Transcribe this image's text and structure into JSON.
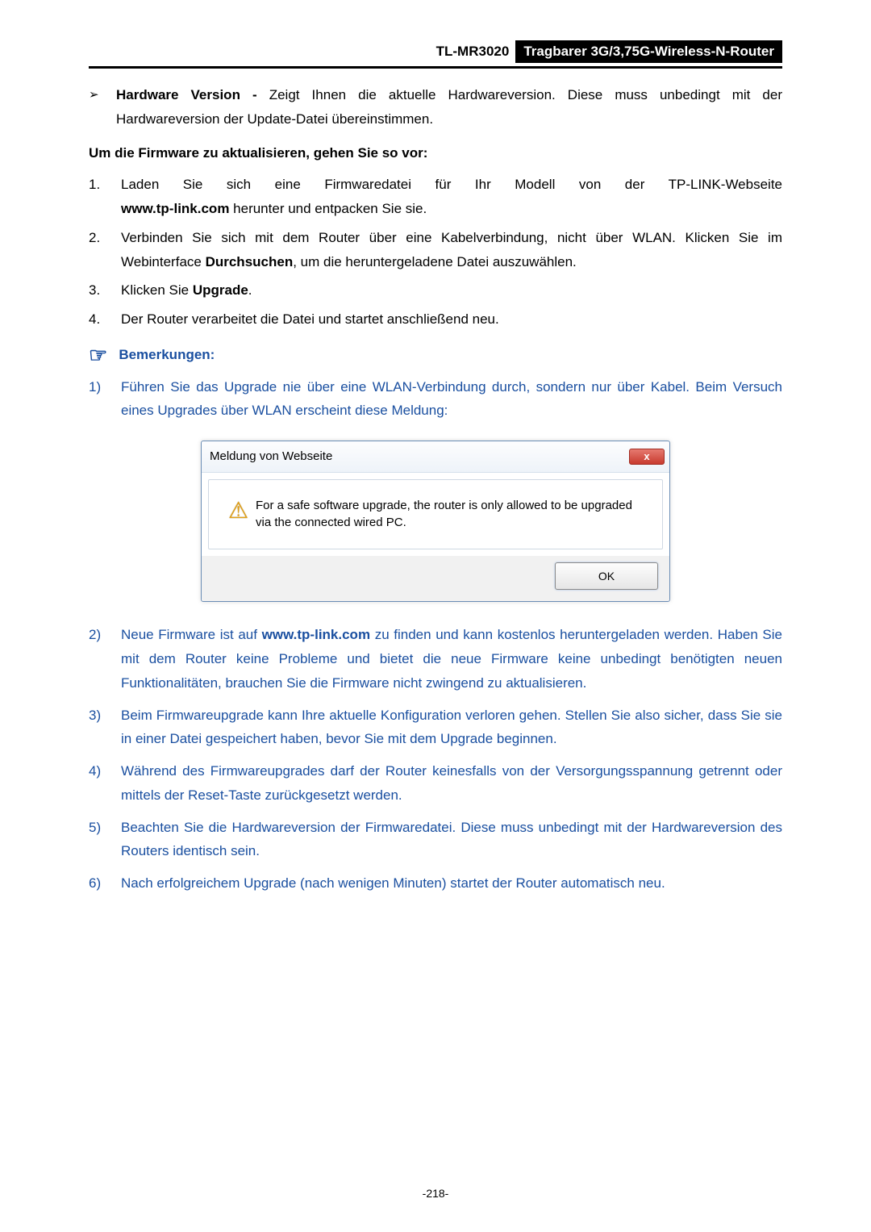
{
  "header": {
    "model": "TL-MR3020",
    "subtitle": "Tragbarer 3G/3,75G-Wireless-N-Router"
  },
  "bullet": {
    "symbol": "➢",
    "label": "Hardware Version - ",
    "text": "Zeigt Ihnen die aktuelle Hardwareversion. Diese muss unbedingt mit der Hardwareversion der Update-Datei übereinstimmen."
  },
  "subhead": "Um die Firmware zu aktualisieren, gehen Sie so vor:",
  "steps": [
    {
      "num": "1.",
      "pre": "Laden Sie sich eine Firmwaredatei für Ihr Modell von der TP-LINK-Webseite ",
      "bold1": "www.tp-link.com",
      "post": " herunter und entpacken Sie sie.",
      "justifyFirst": true
    },
    {
      "num": "2.",
      "pre": "Verbinden Sie sich mit dem Router über eine Kabelverbindung, nicht über WLAN. Klicken Sie im Webinterface ",
      "bold1": "Durchsuchen",
      "post": ", um die heruntergeladene Datei auszuwählen."
    },
    {
      "num": "3.",
      "pre": "Klicken Sie ",
      "bold1": "Upgrade",
      "post": "."
    },
    {
      "num": "4.",
      "pre": "Der Router verarbeitet die Datei und startet anschließend neu.",
      "bold1": "",
      "post": ""
    }
  ],
  "notes_heading": "Bemerkungen:",
  "note1": {
    "num": "1)",
    "text": "Führen Sie das Upgrade nie über eine WLAN-Verbindung durch, sondern nur über Kabel. Beim Versuch eines Upgrades über WLAN erscheint diese Meldung:"
  },
  "dialog": {
    "title": "Meldung von Webseite",
    "close": "x",
    "message": "For a safe software upgrade, the router is only allowed to be upgraded via the connected wired PC.",
    "ok": "OK"
  },
  "notes_rest": [
    {
      "num": "2)",
      "pre": "Neue Firmware ist auf ",
      "bold1": "www.tp-link.com",
      "post": " zu finden und kann kostenlos heruntergeladen werden. Haben Sie mit dem Router keine Probleme und bietet die neue Firmware keine unbedingt benötigten neuen Funktionalitäten, brauchen Sie die Firmware nicht zwingend zu aktualisieren."
    },
    {
      "num": "3)",
      "pre": "Beim Firmwareupgrade kann Ihre aktuelle Konfiguration verloren gehen. Stellen Sie also sicher, dass Sie sie in einer Datei gespeichert haben, bevor Sie mit dem Upgrade beginnen.",
      "bold1": "",
      "post": ""
    },
    {
      "num": "4)",
      "pre": "Während des Firmwareupgrades darf der Router keinesfalls von der Versorgungsspannung getrennt oder mittels der Reset-Taste zurückgesetzt werden.",
      "bold1": "",
      "post": ""
    },
    {
      "num": "5)",
      "pre": "Beachten Sie die Hardwareversion der Firmwaredatei. Diese muss unbedingt mit der Hardwareversion des Routers identisch sein.",
      "bold1": "",
      "post": ""
    },
    {
      "num": "6)",
      "pre": "Nach erfolgreichem Upgrade (nach wenigen Minuten) startet der Router automatisch neu.",
      "bold1": "",
      "post": ""
    }
  ],
  "page_number": "-218-"
}
